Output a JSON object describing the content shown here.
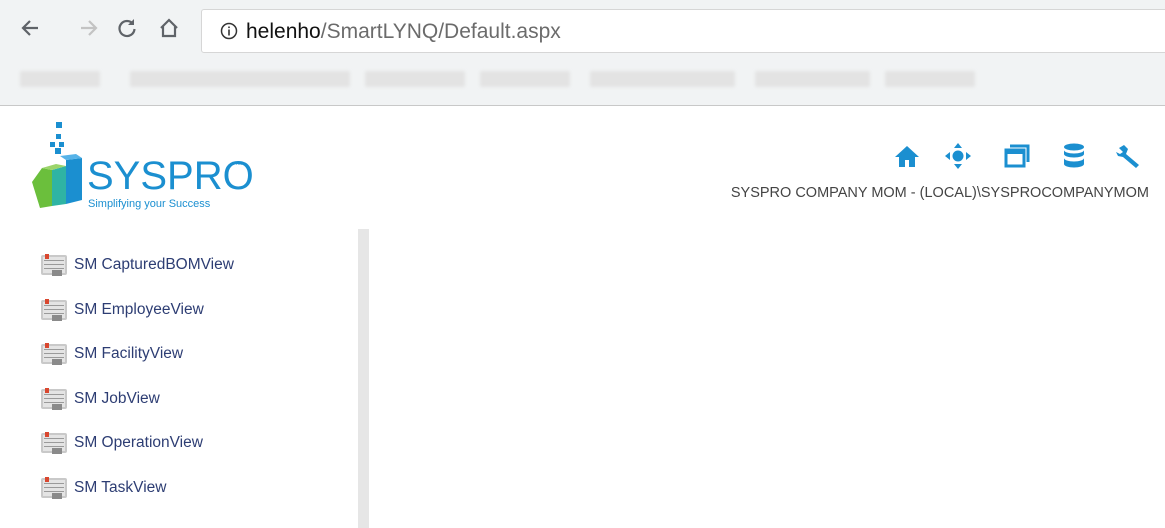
{
  "browser": {
    "url_host": "helenho",
    "url_path": "/SmartLYNQ/Default.aspx"
  },
  "logo": {
    "name": "SYSPRO",
    "tm": "™",
    "tagline": "Simplifying your Success"
  },
  "header": {
    "company": "SYSPRO COMPANY MOM - (LOCAL)\\SYSPROCOMPANYMOM",
    "icons": [
      "home-icon",
      "move-icon",
      "windows-icon",
      "database-icon",
      "wrench-icon"
    ],
    "icon_color": "#1b8fd0"
  },
  "sidebar": {
    "items": [
      {
        "label": "SM CapturedBOMView"
      },
      {
        "label": "SM EmployeeView"
      },
      {
        "label": "SM FacilityView"
      },
      {
        "label": "SM JobView"
      },
      {
        "label": "SM OperationView"
      },
      {
        "label": "SM TaskView"
      }
    ]
  }
}
